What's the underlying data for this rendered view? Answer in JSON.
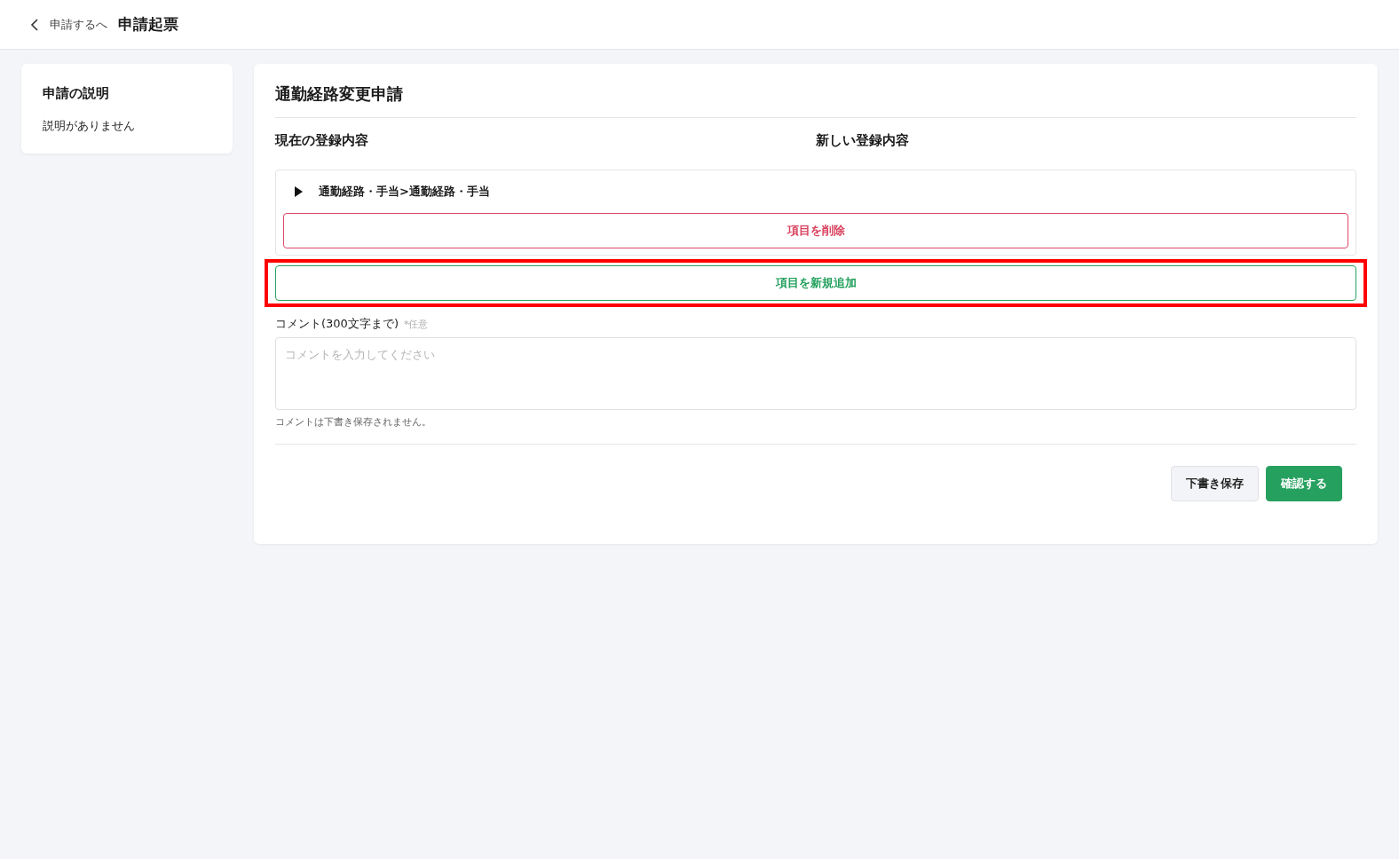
{
  "header": {
    "back_link": "申請するへ",
    "title": "申請起票"
  },
  "sidebar": {
    "title": "申請の説明",
    "description": "説明がありません"
  },
  "form": {
    "title": "通勤経路変更申請",
    "columns": [
      "現在の登録内容",
      "新しい登録内容"
    ],
    "section": {
      "label": "通勤経路・手当>通勤経路・手当",
      "expanded": false,
      "delete_button": "項目を削除"
    },
    "add_button": {
      "label": "項目を新規追加",
      "highlighted": true
    },
    "comment": {
      "label": "コメント(300文字まで)",
      "optional": "*任意",
      "placeholder": "コメントを入力してください",
      "note": "コメントは下書き保存されません。"
    },
    "buttons": [
      {
        "label": "下書き保存",
        "kind": "secondary"
      },
      {
        "label": "確認する",
        "kind": "primary"
      }
    ]
  }
}
